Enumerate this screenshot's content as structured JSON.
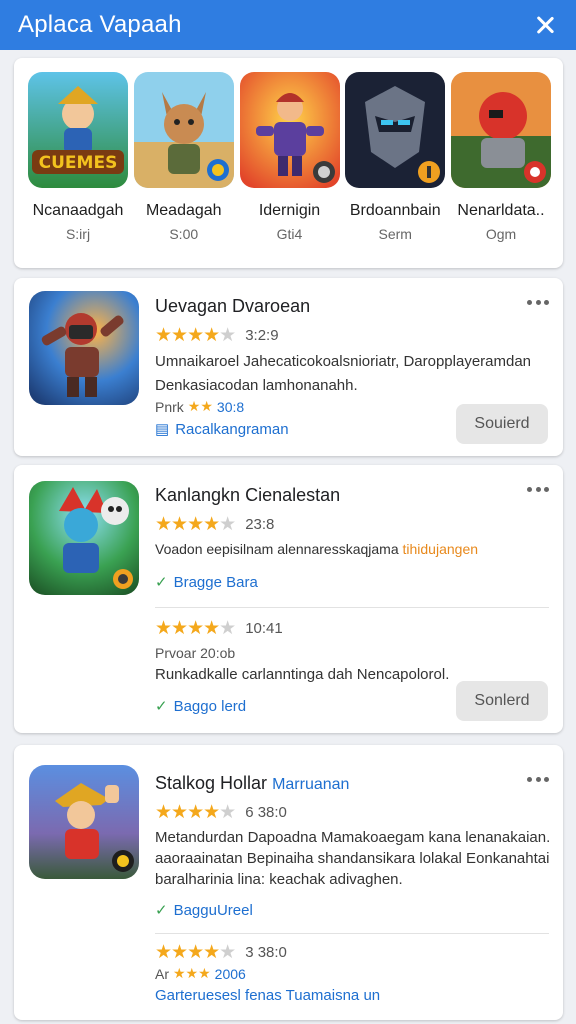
{
  "header": {
    "title": "Aplaca Vapaah"
  },
  "games": [
    {
      "name": "Ncanaadgah",
      "size": "S:irj",
      "color": "#2e8b3d",
      "accent": "#f3c21e",
      "label": "CUEMES"
    },
    {
      "name": "Meadagah",
      "size": "S:00",
      "color": "#d9b066",
      "accent": "#8a6c3b"
    },
    {
      "name": "Idernigin",
      "size": "Gti4",
      "color": "#f08a24",
      "accent": "#5b3f9e"
    },
    {
      "name": "Brdoannbain",
      "size": "Serm",
      "color": "#27324a",
      "accent": "#3dc4f0"
    },
    {
      "name": "Nenarldata..",
      "size": "Ogm",
      "color": "#d8532a",
      "accent": "#3e6a2e"
    }
  ],
  "apps": [
    {
      "title": "Uevagan Dvaroean",
      "stars": "★★★★",
      "stars_off": "★",
      "rating": "3:2:9",
      "desc": [
        "Umnaikaroel Jahecaticokoalsnioriatr, Daropplayeramdan",
        "Denkasiacodan lamhonanahh."
      ],
      "meta_label": "Pnrk",
      "meta_stars": "★★",
      "meta_value": "30:8",
      "link": "Racalkangraman",
      "button": "Souierd"
    },
    {
      "title": "Kanlangkn Cienalestan",
      "stars": "★★★★",
      "stars_off": "★",
      "rating": "23:8",
      "desc_plain": "Voadon eepisilnam alennaresskaqjama ",
      "desc_hl": "tihidujangen",
      "link": "Bragge Bara",
      "stars2": "★★★★",
      "stars2_off": "★",
      "rating2": "10:41",
      "sub_label": "Prvoar 20:ob",
      "sub_desc": "Runkadkalle carlanntinga dah Nencapolorol.",
      "link2": "Baggo lerd",
      "button": "Sonlerd"
    },
    {
      "title": "Stalkog Hollar",
      "title_accent": "Marruanan",
      "stars": "★★★★",
      "stars_off": "★",
      "rating": "6  38:0",
      "desc": [
        "Metandurdan Dapoadna Mamakoaegam kana lenanakaian.",
        "aaoraainatan Bepinaiha shandansikara lolakal Eonkanahtai",
        "baralharinia lina: keachak adivaghen."
      ],
      "link": "BagguUreel",
      "stars2": "★★★★",
      "stars2_off": "★",
      "rating2": "3  38:0",
      "meta_label": "Ar",
      "meta_stars": "★★★",
      "meta_value": "2006",
      "footer": "Garteruesesl fenas Tuamaisna un"
    }
  ]
}
